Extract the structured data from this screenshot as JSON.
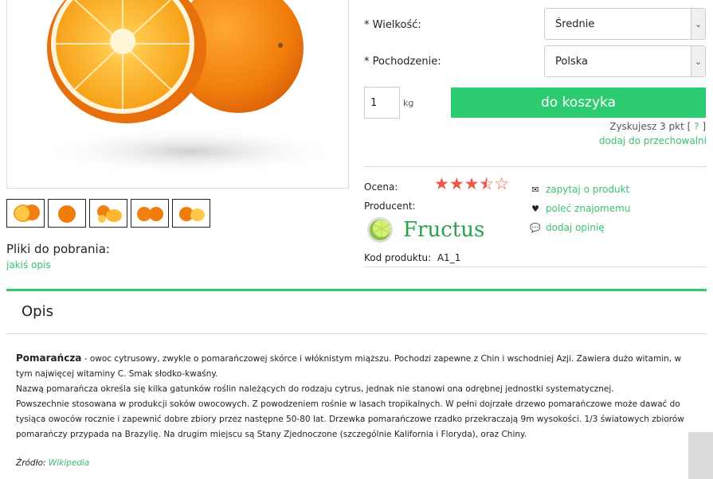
{
  "gallery": {
    "thumbnails": [
      "orange-halves",
      "whole-orange",
      "orange-slices",
      "two-oranges",
      "orange-and-half"
    ]
  },
  "downloads": {
    "title": "Pliki do pobrania:",
    "file_link": "jakiś opis"
  },
  "options": {
    "size_label": "* Wielkość:",
    "size_value": "Średnie",
    "origin_label": "* Pochodzenie:",
    "origin_value": "Polska"
  },
  "cart": {
    "quantity": "1",
    "unit": "kg",
    "button": "do koszyka",
    "points_text": "Zyskujesz 3 pkt [",
    "points_help": "?",
    "points_close": "]",
    "store_link": "dodaj do przechowalni"
  },
  "product": {
    "rating_label": "Ocena:",
    "rating": 3.5,
    "rating_max": 5,
    "producer_label": "Producent:",
    "producer_name": "Fructus",
    "code_label": "Kod produktu:",
    "code_value": "A1_1"
  },
  "actions": {
    "ask": "zapytaj o produkt",
    "recommend": "poleć znajomemu",
    "review": "dodaj opinię"
  },
  "description": {
    "tab_title": "Opis",
    "term": "Pomarańcza",
    "line1": " - owoc cytrusowy, zwykle o pomarańczowej skórce i włóknistym miąższu. Pochodzi zapewne z Chin i wschodniej Azji. Zawiera dużo witamin, w tym najwięcej witaminy C. Smak słodko-kwaśny.",
    "line2": "Nazwą pomarańcza określa się kilka gatunków roślin należących do rodzaju cytrus, jednak nie stanowi ona odrębnej jednostki systematycznej.",
    "line3": "Powszechnie stosowana w produkcji soków owocowych. Z powodzeniem rośnie w lasach tropikalnych. W pełni dojrzałe drzewo pomarańczowe może dawać do tysiąca owoców rocznie i zapewnić dobre zbiory przez następne 50-80 lat. Drzewka pomarańczowe rzadko przekraczają 9m wysokości. 1/3 światowych zbiorów pomarańczy przypada na Brazylię. Na drugim miejscu są Stany Zjednoczone (szczególnie Kalifornia i Floryda), oraz Chiny.",
    "source_label": "Źródło: ",
    "source_link": "Wikipedia"
  },
  "colors": {
    "accent": "#2ecc71",
    "link": "#3cc070",
    "star": "#f05545"
  }
}
